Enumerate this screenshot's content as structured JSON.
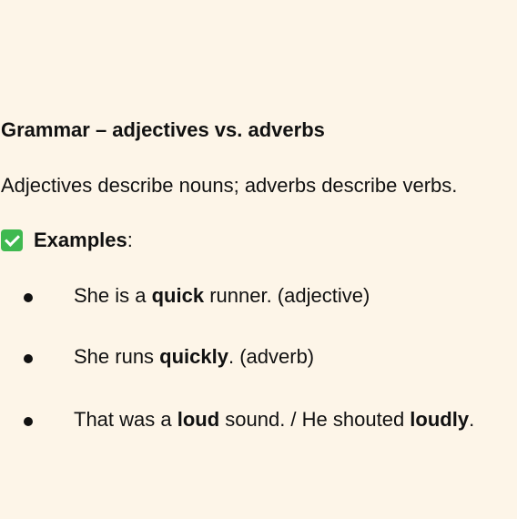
{
  "heading": "Grammar – adjectives vs. adverbs",
  "intro": "Adjectives describe nouns; adverbs describe verbs.",
  "examples": {
    "icon": "check-mark-icon",
    "icon_color": "#3fb950",
    "label": "Examples",
    "colon": ":"
  },
  "items": [
    {
      "pre": "She is a ",
      "bold": "quick",
      "post": " runner. (adjective)"
    },
    {
      "pre": "She runs ",
      "bold": "quickly",
      "post": ". (adverb)"
    },
    {
      "pre": "That was a ",
      "bold": "loud",
      "mid": " sound. / He shouted ",
      "bold2": "loudly",
      "post": "."
    }
  ]
}
